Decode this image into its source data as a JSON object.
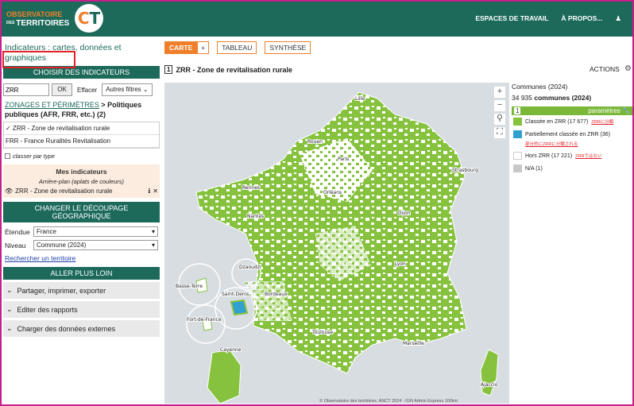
{
  "header": {
    "logo_top": "OBSERVATOIRE",
    "logo_small": "DES",
    "logo_bottom": "TERRITOIRES",
    "nav": [
      "ESPACES DE TRAVAIL",
      "À PROPOS..."
    ]
  },
  "left": {
    "title": "Indicateurs : cartes, données et graphiques",
    "choose_head": "CHOISIR DES INDICATEURS",
    "search_value": "ZRR",
    "ok": "OK",
    "effacer": "Effacer",
    "autres": "Autres filtres",
    "crumb_link": "ZONAGES ET PÉRIMÈTRES",
    "crumb_rest": " > Politiques publiques (AFR, FRR, etc.) (2)",
    "items": [
      "✓ ZRR - Zone de revitalisation rurale",
      "FRR - France Ruralités Revitalisation"
    ],
    "classer": "classer par type",
    "mine_head": "Mes indicateurs",
    "mine_sub": "Arrière-plan (aplats de couleurs)",
    "mine_item": "ZRR - Zone de revitalisation rurale",
    "decoupage_head": "CHANGER LE DÉCOUPAGE GÉOGRAPHIQUE",
    "etendue_label": "Étendue",
    "etendue_value": "France",
    "niveau_label": "Niveau",
    "niveau_value": "Commune (2024)",
    "rechercher": "Rechercher un territoire",
    "plus_loin_head": "ALLER PLUS LOIN",
    "accordions": [
      "Partager, imprimer, exporter",
      "Editer des rapports",
      "Charger des données externes"
    ]
  },
  "tabs": {
    "carte": "CARTE",
    "plus": "+",
    "tableau": "TABLEAU",
    "synthese": "SYNTHÈSE"
  },
  "map": {
    "number": "1",
    "title": "ZRR - Zone de revitalisation rurale",
    "actions": "ACTIONS",
    "cities": [
      "Lille",
      "Rouen",
      "Paris",
      "Strasbourg",
      "Rennes",
      "Orléans",
      "Nantes",
      "Dijon",
      "Lyon",
      "Bordeaux",
      "Toulouse",
      "Marseille",
      "Ajaccio",
      "Basse-Terre",
      "Dzaoudzi",
      "Saint-Denis",
      "Fort-de-France",
      "Cayenne"
    ],
    "copyright": "© Observatoire des territoires, ANCT 2024 - IGN Admin Express  100km",
    "colors": {
      "green": "#86c23e",
      "blue": "#2fa0d0",
      "white": "#ffffff",
      "na": "#c8c8c8"
    }
  },
  "legend": {
    "communes": "Communes (2024)",
    "count": "34 935",
    "count_label": " communes (2024)",
    "num": "1",
    "params": "paramètres",
    "rows": [
      {
        "label": "Classée en ZRR (17 677)",
        "note": "ZRRに分類",
        "color": "#86c23e"
      },
      {
        "label": "Partiellement classée en ZRR (36)",
        "note": "部分的にZRRに分類される",
        "color": "#2fa0d0"
      },
      {
        "label": "Hors ZRR (17 221)",
        "note": "ZRRではない",
        "color": "#ffffff"
      },
      {
        "label": "N/A (1)",
        "note": "",
        "color": "#c8c8c8"
      }
    ]
  }
}
